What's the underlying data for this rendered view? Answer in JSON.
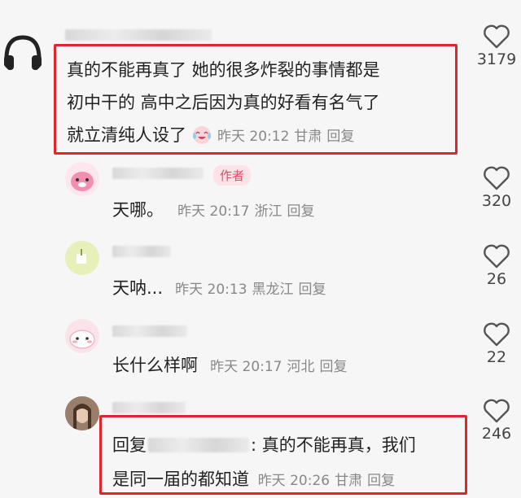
{
  "comments": [
    {
      "text_lines": [
        "真的不能再真了 她的很多炸裂的事情都是",
        "初中干的 高中之后因为真的好看有名气了",
        "就立清纯人设了"
      ],
      "time": "昨天 20:12",
      "location": "甘肃",
      "reply": "回复",
      "likes": "3179"
    },
    {
      "badge": "作者",
      "text": "天哪。",
      "time": "昨天 20:17",
      "location": "浙江",
      "reply": "回复",
      "likes": "320"
    },
    {
      "text": "天呐...",
      "time": "昨天 20:13",
      "location": "黑龙江",
      "reply": "回复",
      "likes": "26"
    },
    {
      "text": "长什么样啊",
      "time": "昨天 20:17",
      "location": "河北",
      "reply": "回复",
      "likes": "22"
    },
    {
      "reply_prefix": "回复",
      "text_line1": ": 真的不能再真，我们",
      "text_line2": "是同一届的都知道",
      "time": "昨天 20:26",
      "location": "甘肃",
      "reply": "回复",
      "likes": "246"
    }
  ],
  "colors": {
    "highlight": "#e0262b",
    "author_badge": "#e8476a"
  },
  "icons": {
    "like": "heart-outline-icon",
    "emoji": "laughing-crying-emoji-icon"
  }
}
